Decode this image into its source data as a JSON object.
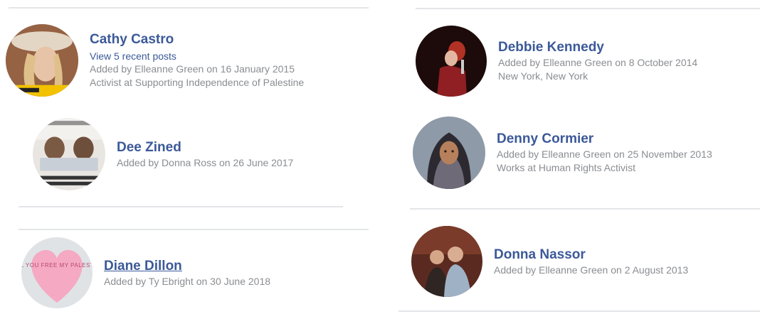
{
  "friends": [
    {
      "name": "Cathy Castro",
      "recent_posts": "View 5 recent posts",
      "added": "Added by Elleanne Green on 16 January 2015",
      "detail": "Activist at Supporting Independence of Palestine",
      "avatar": "woman-with-hat-photo"
    },
    {
      "name": "Dee Zined",
      "added": "Added by Donna Ross on 26 June 2017",
      "avatar": "poster-photo"
    },
    {
      "name": "Diane Dillon",
      "added": "Added by Ty Ebright on 30 June 2018",
      "avatar": "heart-candy-photo",
      "avatar_text": "WILL YOU FREE MY PALESTINE"
    },
    {
      "name": "Debbie Kennedy",
      "added": "Added by Elleanne Green on 8 October 2014",
      "detail": "New York, New York",
      "avatar": "woman-singing-photo"
    },
    {
      "name": "Denny Cormier",
      "added": "Added by Elleanne Green on 25 November 2013",
      "detail": "Works at Human Rights Activist",
      "avatar": "woman-in-hijab-photo"
    },
    {
      "name": "Donna Nassor",
      "added": "Added by Elleanne Green on 2 August 2013",
      "avatar": "two-people-photo"
    }
  ],
  "colors": {
    "name_link": "#3b5998",
    "meta_text": "#8a8d91",
    "divider": "#e3e5e8"
  }
}
